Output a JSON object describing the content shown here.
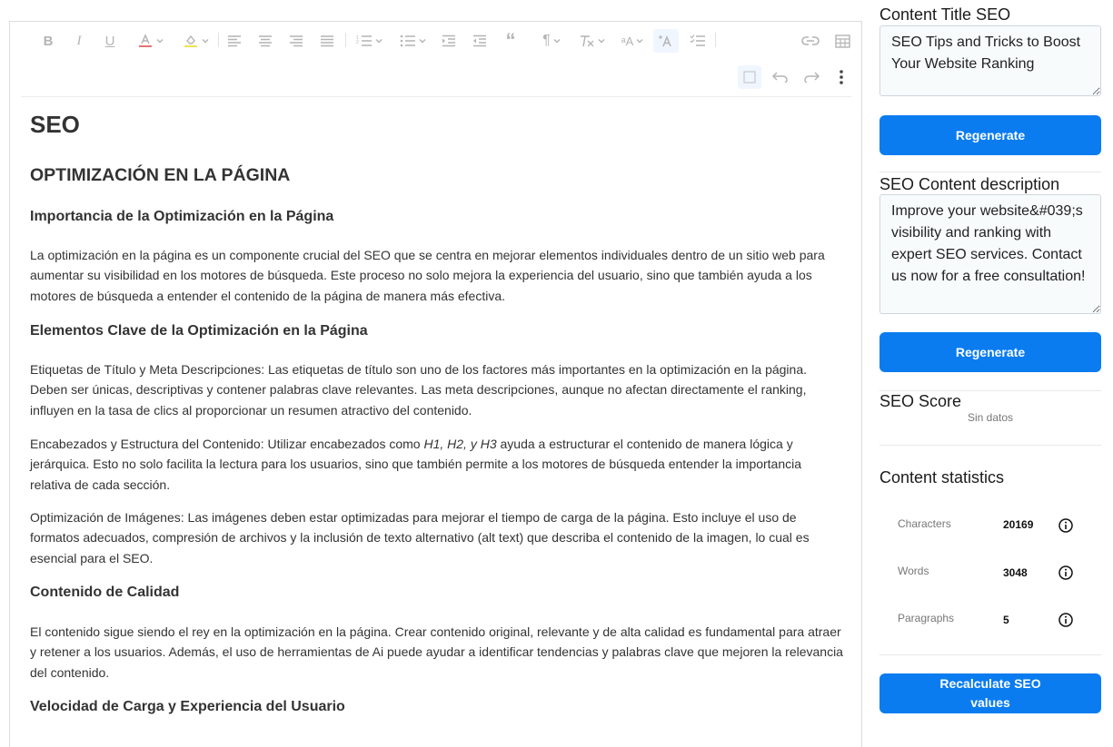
{
  "editor": {
    "toolbar": {
      "buttons": [
        "bold-icon",
        "italic-icon",
        "underline-icon",
        "font-color-icon",
        "highlight-icon",
        "align-left-icon",
        "align-center-icon",
        "align-right-icon",
        "align-justify-icon",
        "numbered-list-icon",
        "bulleted-list-icon",
        "indent-icon",
        "outdent-icon",
        "blockquote-icon",
        "paragraph-icon",
        "remove-format-icon",
        "text-case-icon",
        "ai-text-icon",
        "checklist-icon",
        "link-icon",
        "table-icon",
        "select-all-icon",
        "undo-icon",
        "redo-icon",
        "more-icon"
      ],
      "accent": "#e53935"
    },
    "content": {
      "h1": "SEO",
      "h2": "OPTIMIZACIÓN EN LA PÁGINA",
      "s1_title": "Importancia de la Optimización en la Página",
      "s1_p1": "La optimización en la página es un componente crucial del SEO que se centra en mejorar elementos individuales dentro de un sitio web para aumentar su visibilidad en los motores de búsqueda. Este proceso no solo mejora la experiencia del usuario, sino que también ayuda a los motores de búsqueda a entender el contenido de la página de manera más efectiva.",
      "s2_title": "Elementos Clave de la Optimización en la Página",
      "s2_p1": "Etiquetas de Título y Meta Descripciones: Las etiquetas de título son uno de los factores más importantes en la optimización en la página. Deben ser únicas, descriptivas y contener palabras clave relevantes. Las meta descripciones, aunque no afectan directamente el ranking, influyen en la tasa de clics al proporcionar un resumen atractivo del contenido.",
      "s2_p2_a": "Encabezados y Estructura del Contenido: Utilizar encabezados como ",
      "s2_p2_em": "H1, H2, y H3",
      "s2_p2_b": " ayuda a estructurar el contenido de manera lógica y jerárquica. Esto no solo facilita la lectura para los usuarios, sino que también permite a los motores de búsqueda entender la importancia relativa de cada sección.",
      "s2_p3": "Optimización de Imágenes: Las imágenes deben estar optimizadas para mejorar el tiempo de carga de la página. Esto incluye el uso de formatos adecuados, compresión de archivos y la inclusión de texto alternativo (alt text) que describa el contenido de la imagen, lo cual es esencial para el SEO.",
      "s3_title": "Contenido de Calidad",
      "s3_p1": "El contenido sigue siendo el rey en la optimización en la página. Crear contenido original, relevante y de alta calidad es fundamental para atraer y retener a los usuarios. Además, el uso de herramientas de Ai puede ayudar a identificar tendencias y palabras clave que mejoren la relevancia del contenido.",
      "s4_title": "Velocidad de Carga y Experiencia del Usuario"
    }
  },
  "sidebar": {
    "title_label": "Content Title SEO",
    "title_value": "SEO Tips and Tricks to Boost Your Website Ranking",
    "regenerate_label": "Regenerate",
    "desc_label": "SEO Content description",
    "desc_value": "Improve your website&#039;s visibility and ranking with expert SEO services. Contact us now for a free consultation!",
    "score_label": "SEO Score",
    "score_value": "Sin datos",
    "stats_title": "Content statistics",
    "stats": [
      {
        "label": "Characters",
        "value": "20169"
      },
      {
        "label": "Words",
        "value": "3048"
      },
      {
        "label": "Paragraphs",
        "value": "5"
      }
    ],
    "recalc_label": "Recalculate SEO values",
    "button_color": "#0a7cf0"
  }
}
